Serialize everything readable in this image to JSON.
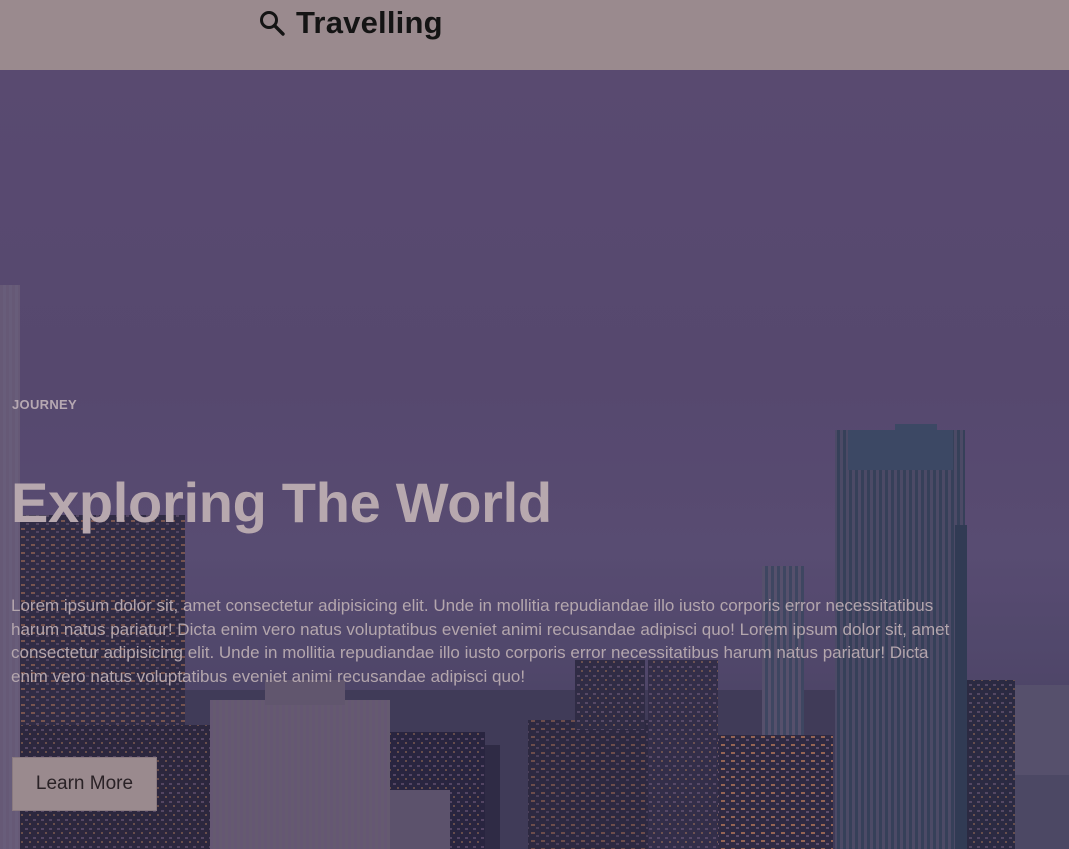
{
  "header": {
    "brand_label": "Travelling",
    "search_icon": "search-icon"
  },
  "hero": {
    "eyebrow": "JOURNEY",
    "title": "Exploring The World",
    "body": "Lorem ipsum dolor sit, amet consectetur adipisicing elit. Unde in mollitia repudiandae illo iusto corporis error necessitatibus harum natus pariatur! Dicta enim vero natus voluptatibus eveniet animi recusandae adipisci quo! Lorem ipsum dolor sit, amet consectetur adipisicing elit. Unde in mollitia repudiandae illo iusto corporis error necessitatibus harum natus pariatur! Dicta enim vero natus voluptatibus eveniet animi recusandae adipisci quo!",
    "cta_label": "Learn More"
  },
  "colors": {
    "header_bg": "#9a8a8e",
    "hero_tint": "#5a4c72",
    "text_light": "#b7a8ae",
    "button_bg": "#9a8a8e"
  }
}
